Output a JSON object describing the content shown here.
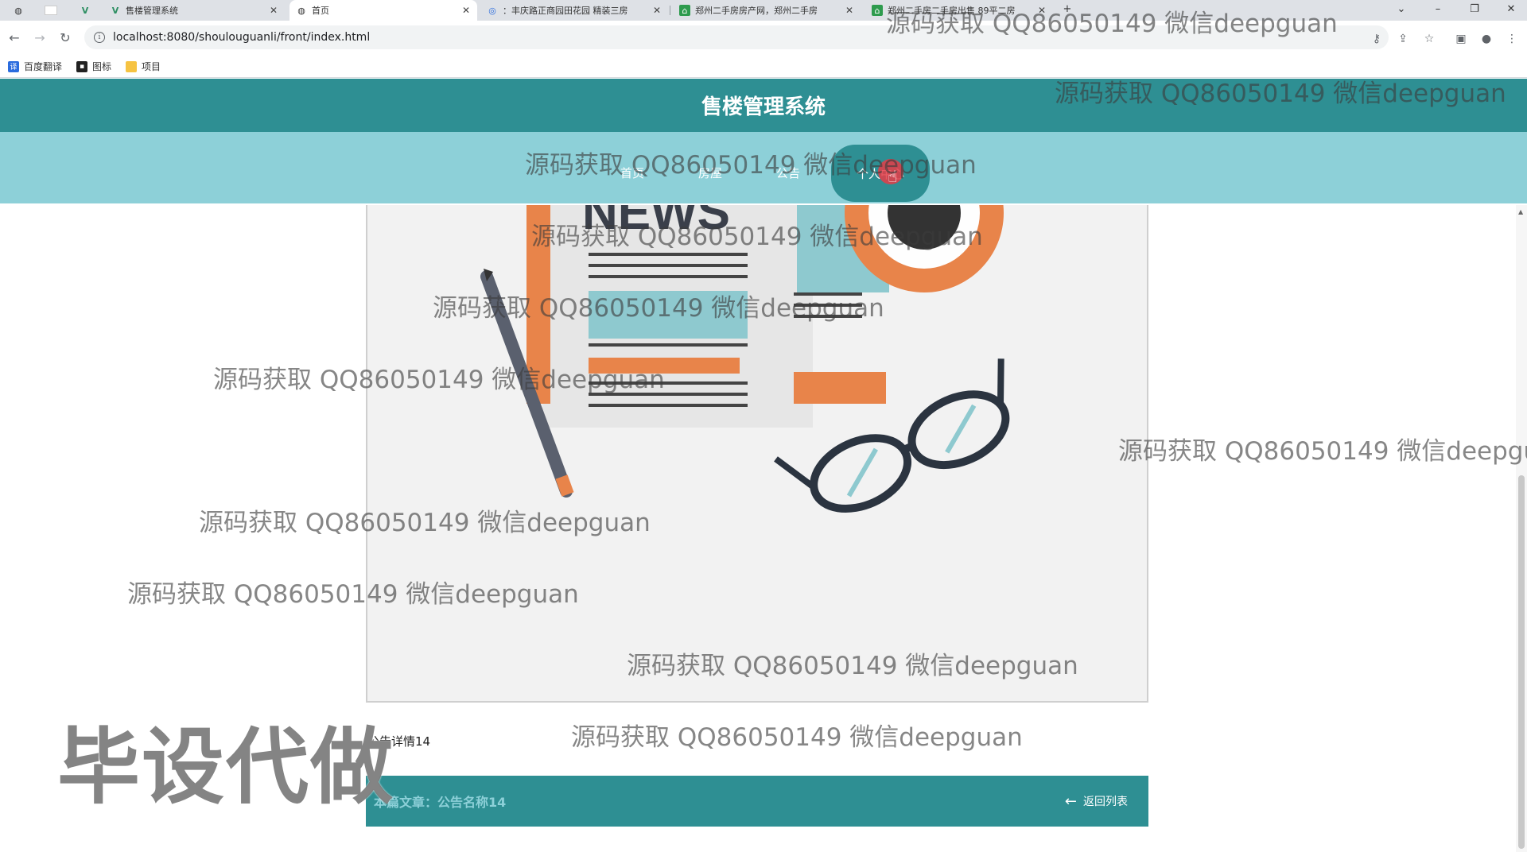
{
  "browser": {
    "tabs": [
      {
        "title": "",
        "icon": "globe-icon",
        "active": false
      },
      {
        "title": "",
        "icon": "blank-page-icon",
        "active": false
      },
      {
        "title": "",
        "icon": "vue-icon",
        "active": false
      },
      {
        "title": "售楼管理系统",
        "icon": "vue-icon",
        "active": false
      },
      {
        "title": "首页",
        "icon": "globe-icon",
        "active": true
      },
      {
        "title": "：丰庆路正商园田花园 精装三房",
        "icon": "blue-circle-icon",
        "active": false
      },
      {
        "title": "郑州二手房房产网，郑州二手房",
        "icon": "green-house-icon",
        "active": false
      },
      {
        "title": "郑州二手房二手房出售 89平二房",
        "icon": "green-house-icon",
        "active": false
      }
    ],
    "url": "localhost:8080/shoulouguanli/front/index.html",
    "bookmarks": [
      {
        "label": "百度翻译",
        "icon": "translate-icon",
        "color": "#2b6cde"
      },
      {
        "label": "图标",
        "icon": "image-icon",
        "color": "#222222"
      },
      {
        "label": "项目",
        "icon": "folder-icon",
        "color": "#f6c342"
      }
    ]
  },
  "site": {
    "title": "售楼管理系统",
    "nav": [
      "首页",
      "房屋",
      "公告",
      "个人中心"
    ],
    "active_nav": "个人中心"
  },
  "article": {
    "image_alt_text": "NEWS",
    "detail": "公告详情14",
    "current_label": "本篇文章：公告名称14",
    "back_label": "返回列表"
  },
  "watermark": {
    "text": "源码获取 QQ86050149 微信deepguan",
    "stamp": "毕设代做"
  },
  "colors": {
    "header": "#2e8f93",
    "nav": "#8dd0d8",
    "bottom_bar": "#2e8f93"
  }
}
